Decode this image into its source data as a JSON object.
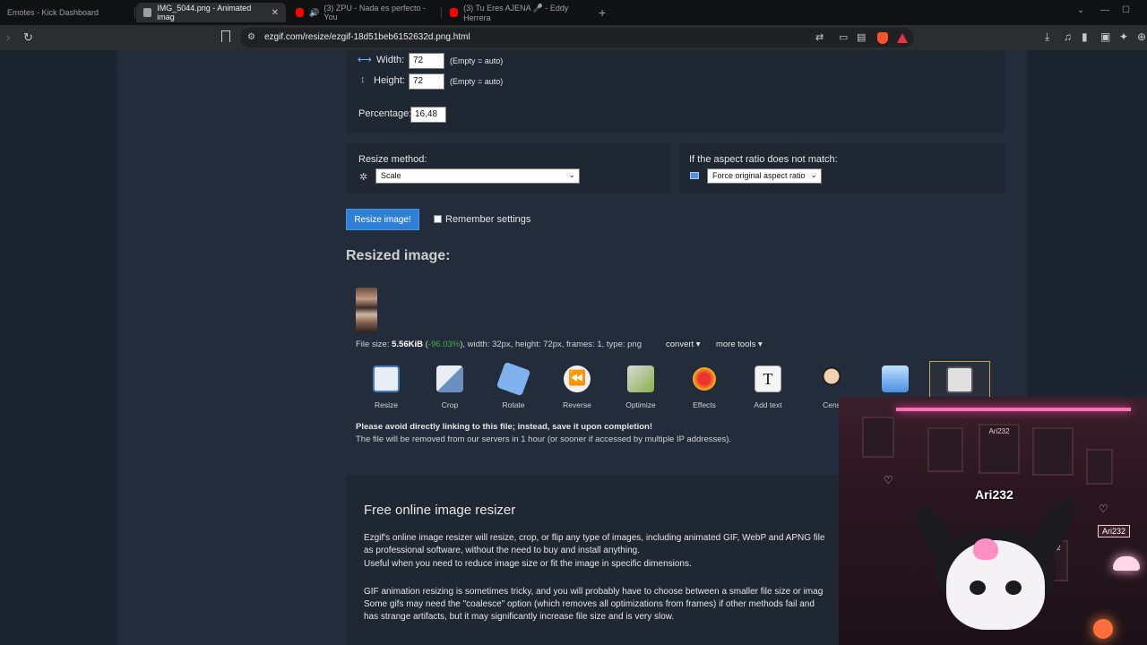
{
  "browser": {
    "tabs": [
      {
        "title": "Emotes - Kick Dashboard"
      },
      {
        "title": "IMG_5044.png - Animated imag",
        "active": true
      },
      {
        "title": "(3) ZPU - Nada es perfecto - You"
      },
      {
        "title": "(3) Tu Eres AJENA 🎤 - Eddy Herrera"
      }
    ],
    "new_tab": "+",
    "url": "ezgif.com/resize/ezgif-18d51beb6152632d.png.html",
    "brand_colors": {
      "youtube": "#ff0000",
      "brave": "#fb542b",
      "accent": "#2f7fd6"
    }
  },
  "resize_form": {
    "width_label": "Width:",
    "width_value": "72",
    "height_label": "Height:",
    "height_value": "72",
    "empty_hint": "(Empty = auto)",
    "percentage_label": "Percentage:",
    "percentage_value": "16,48",
    "method_label": "Resize method:",
    "method_value": "Scale",
    "aspect_label": "If the aspect ratio does not match:",
    "aspect_value": "Force original aspect ratio",
    "submit_label": "Resize image!",
    "remember_label": "Remember settings"
  },
  "result": {
    "heading": "Resized image:",
    "file_size_label": "File size:",
    "file_size": "5.56KiB",
    "size_change": "-96.03%",
    "details": ", width: 32px, height: 72px, frames: 1, type: png",
    "convert_label": "convert",
    "more_tools_label": "more tools",
    "tools": [
      {
        "label": "Resize",
        "icon": "resize-icon"
      },
      {
        "label": "Crop",
        "icon": "crop-icon"
      },
      {
        "label": "Rotate",
        "icon": "rotate-icon"
      },
      {
        "label": "Reverse",
        "icon": "reverse-icon"
      },
      {
        "label": "Optimize",
        "icon": "optimize-icon"
      },
      {
        "label": "Effects",
        "icon": "effects-icon"
      },
      {
        "label": "Add text",
        "icon": "add-text-icon"
      },
      {
        "label": "Cens",
        "icon": "censor-icon"
      },
      {
        "label": "",
        "icon": "info-icon"
      },
      {
        "label": "",
        "icon": "save-icon"
      }
    ],
    "warning": "Please avoid directly linking to this file; instead, save it upon completion!",
    "removal_note": "The file will be removed from our servers in 1 hour (or sooner if accessed by multiple IP addresses)."
  },
  "info": {
    "heading": "Free online image resizer",
    "p1_line1": "Ezgif's online image resizer will resize, crop, or flip any type of images, including animated GIF, WebP and APNG file",
    "p1_line2": "as professional software, without the need to buy and install anything.",
    "p1_line3": "Useful when you need to reduce image size or fit the image in specific dimensions.",
    "p2_line1": "GIF animation resizing is sometimes tricky, and you will probably have to choose between a smaller file size or imag",
    "p2_line2": "Some gifs may need the \"coalesce\" option (which removes all optimizations from frames) if other methods fail and",
    "p2_line3": "has strange artifacts, but it may significantly increase file size and is very slow."
  },
  "overlay": {
    "frame_labels": [
      "Ari232",
      "Ari232"
    ],
    "streamer_name": "Ari232",
    "name_tag": "Ari232"
  }
}
